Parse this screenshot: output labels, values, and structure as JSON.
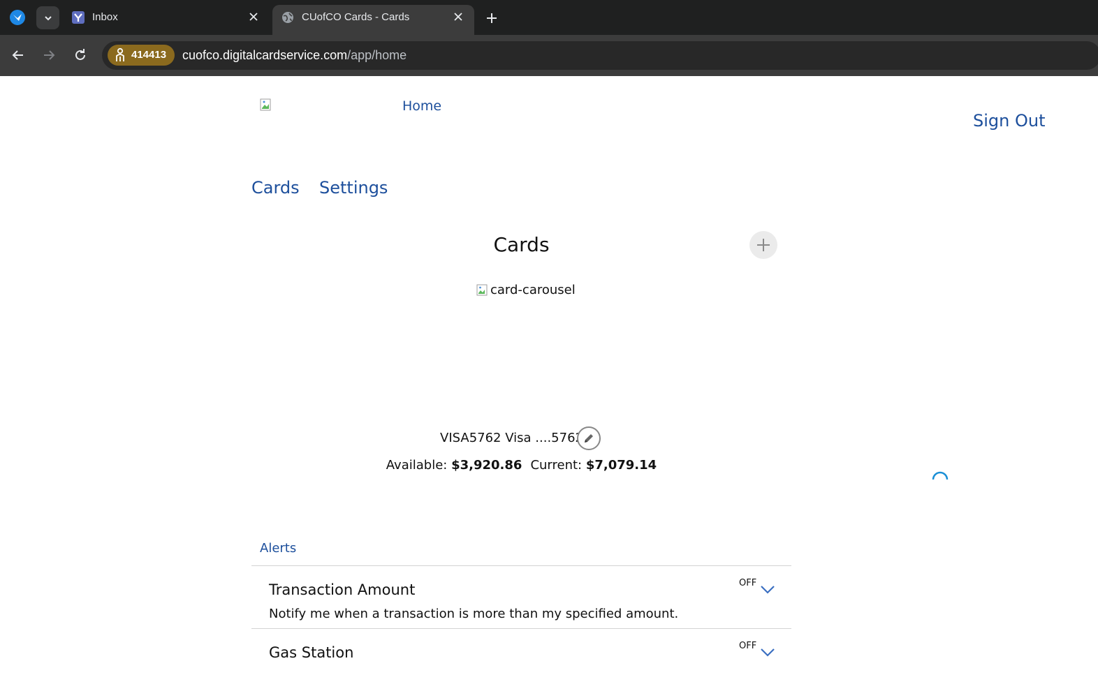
{
  "browser": {
    "tabs": [
      {
        "title": "Inbox",
        "favicon": "yahoo-mail-icon",
        "active": false
      },
      {
        "title": "CUofCO Cards - Cards",
        "favicon": "globe-icon",
        "active": true
      }
    ],
    "address_badge": "414413",
    "url_host": "cuofco.digitalcardservice.com",
    "url_path": "/app/home"
  },
  "header": {
    "home_link": "Home",
    "sign_out": "Sign Out"
  },
  "nav": {
    "cards": "Cards",
    "settings": "Settings"
  },
  "cards_section": {
    "title": "Cards",
    "carousel_alt": "card-carousel",
    "card_name": "VISA5762 Visa ....5762",
    "available_label": "Available:",
    "available_value": "$3,920.86",
    "current_label": "Current:",
    "current_value": "$7,079.14"
  },
  "alerts": {
    "label": "Alerts",
    "items": [
      {
        "title": "Transaction Amount",
        "description": "Notify me when a transaction is more than my specified amount.",
        "state": "OFF"
      },
      {
        "title": "Gas Station",
        "description": "",
        "state": "OFF"
      }
    ]
  },
  "colors": {
    "link": "#1d4f9c",
    "chrome_dark": "#1f2020",
    "chrome_toolbar": "#3c3c3c",
    "badge": "#8b6a1e",
    "chevron": "#3b6fc1",
    "spinner": "#1a8fd6"
  }
}
